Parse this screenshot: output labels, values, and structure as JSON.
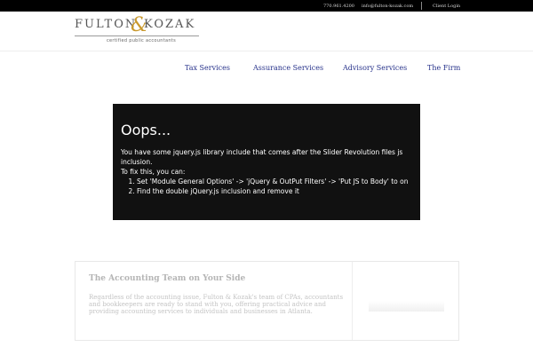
{
  "topbar": {
    "phone": "770.961.4200",
    "email": "info@fulton-kozak.com",
    "login": "Client Login"
  },
  "logo": {
    "word1": "FULTON",
    "ampersand": "&",
    "word2": "KOZAK",
    "tagline": "certified public accountants"
  },
  "nav": {
    "items": [
      {
        "label": "Tax Services"
      },
      {
        "label": "Assurance Services"
      },
      {
        "label": "Advisory Services"
      },
      {
        "label": "The Firm"
      }
    ]
  },
  "error": {
    "title": "Oops...",
    "line1": "You have some jquery.js library include that comes after the Slider Revolution files js inclusion.",
    "line2": "To fix this, you can:",
    "steps": [
      "Set 'Module General Options' -> 'jQuery & OutPut Filters' -> 'Put JS to Body' to on",
      "Find the double jQuery.js inclusion and remove it"
    ]
  },
  "card": {
    "title": "The Accounting Team on Your Side",
    "body": "Regardless of the accounting issue, Fulton & Kozak's team of CPAs, accountants and bookkeepers are ready to stand with you, offering practical advice and providing accounting services to individuals and businesses in Atlanta."
  },
  "colors": {
    "topbar_bg": "#000000",
    "nav_link": "#26318a",
    "logo_accent": "#c9992d",
    "error_bg": "#111111"
  }
}
